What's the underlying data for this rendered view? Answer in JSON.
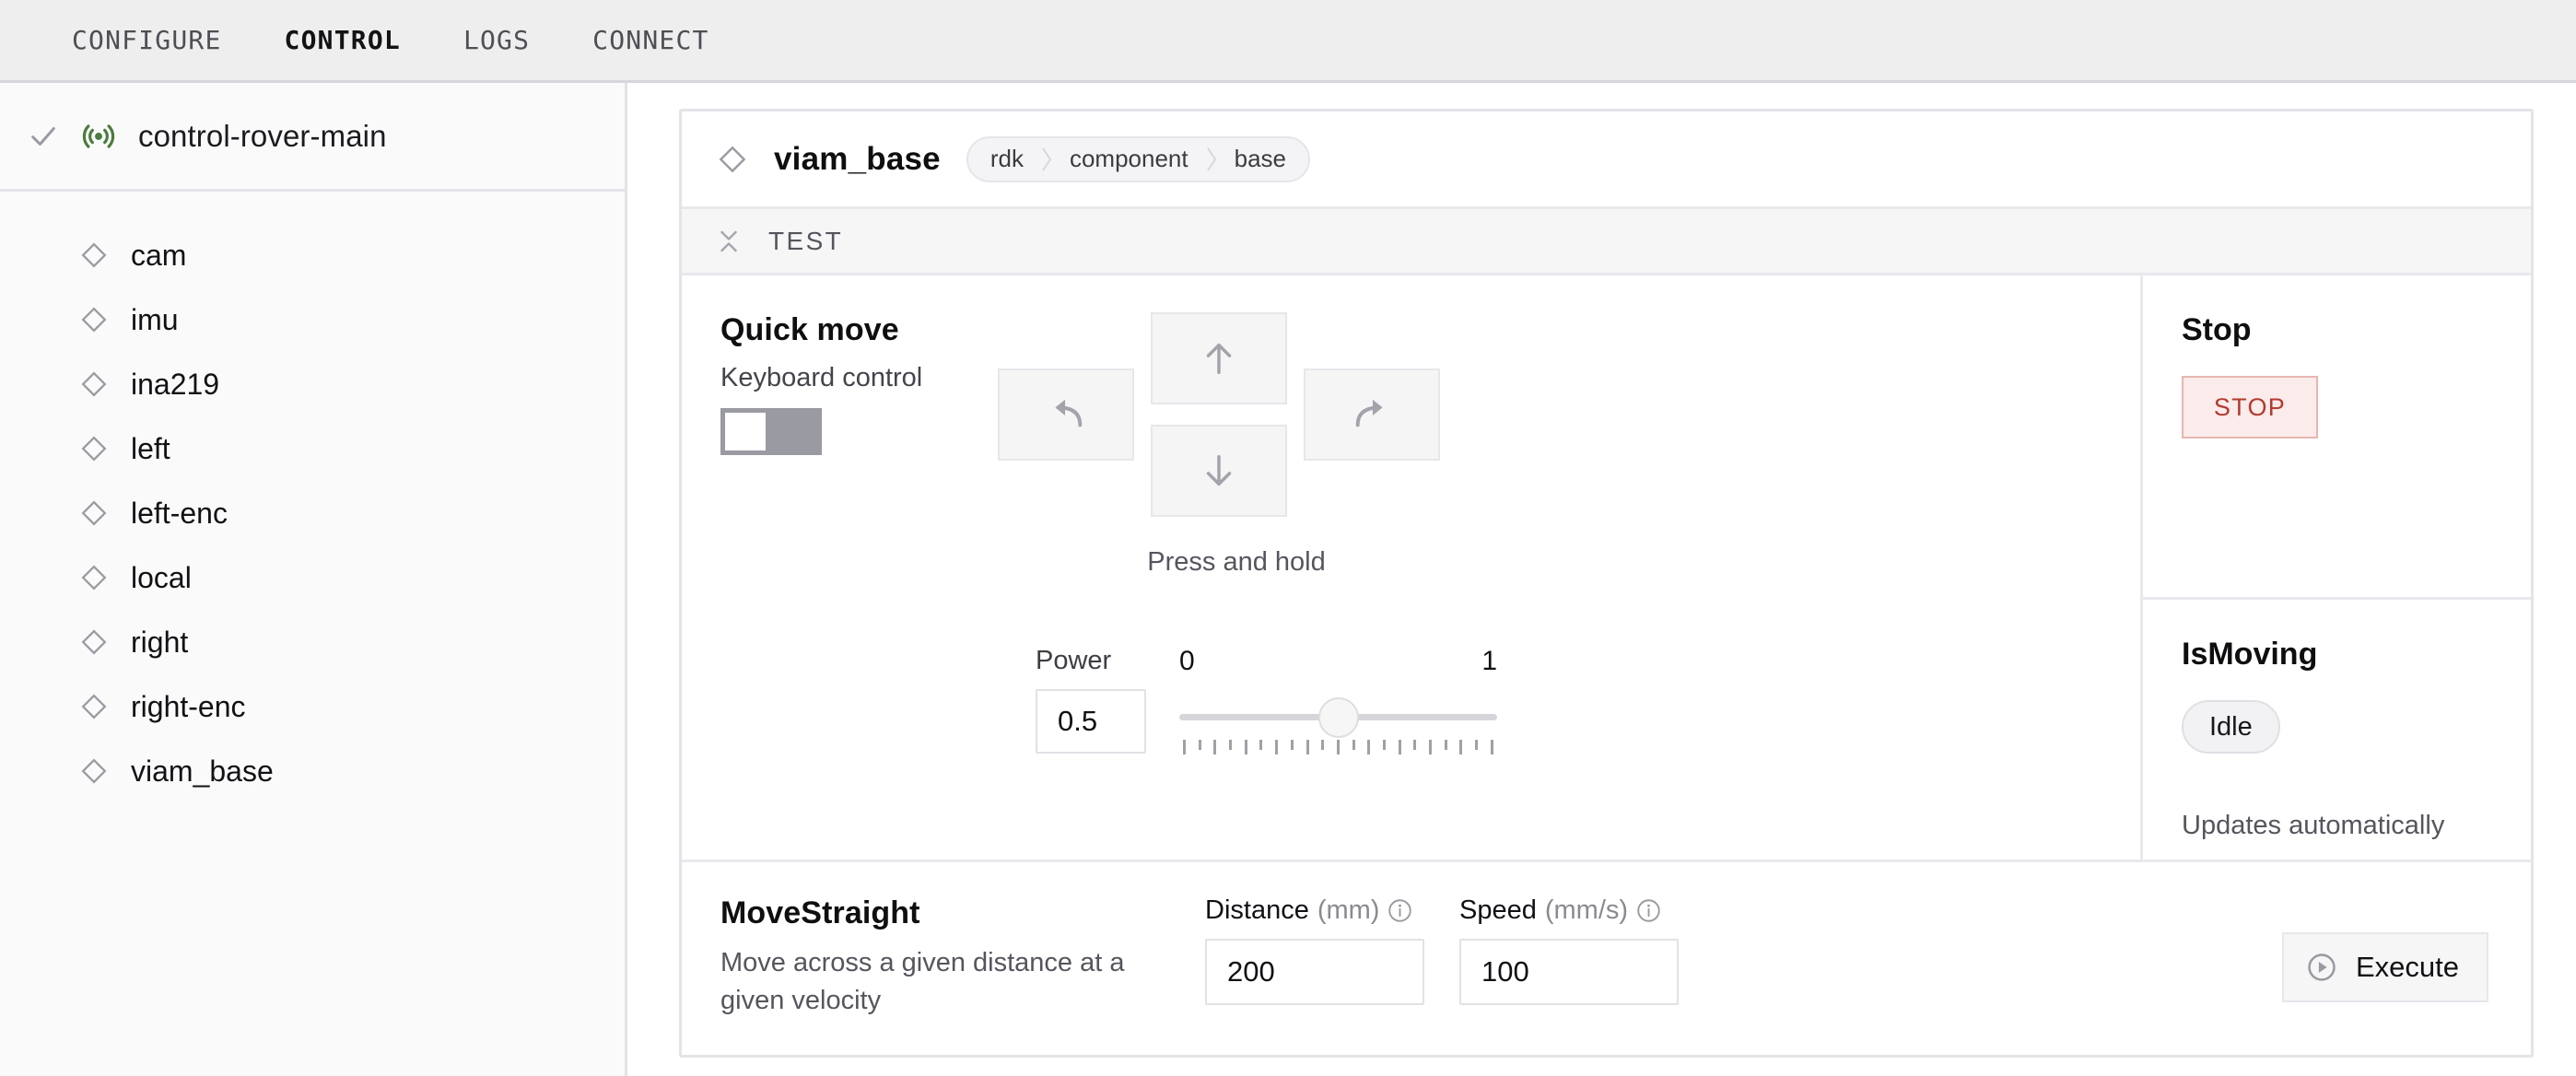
{
  "topnav": {
    "tabs": [
      {
        "label": "CONFIGURE",
        "active": false
      },
      {
        "label": "CONTROL",
        "active": true
      },
      {
        "label": "LOGS",
        "active": false
      },
      {
        "label": "CONNECT",
        "active": false
      }
    ]
  },
  "sidebar": {
    "machine": {
      "name": "control-rover-main",
      "status_icon": "signal-icon",
      "check_icon": "check-icon"
    },
    "resources": [
      {
        "label": "cam",
        "icon": "diamond-icon"
      },
      {
        "label": "imu",
        "icon": "diamond-icon"
      },
      {
        "label": "ina219",
        "icon": "diamond-icon"
      },
      {
        "label": "left",
        "icon": "diamond-icon"
      },
      {
        "label": "left-enc",
        "icon": "diamond-icon"
      },
      {
        "label": "local",
        "icon": "diamond-icon"
      },
      {
        "label": "right",
        "icon": "diamond-icon"
      },
      {
        "label": "right-enc",
        "icon": "diamond-icon"
      },
      {
        "label": "viam_base",
        "icon": "diamond-icon"
      }
    ]
  },
  "card": {
    "title": "viam_base",
    "breadcrumbs": [
      "rdk",
      "component",
      "base"
    ],
    "test_section_label": "TEST"
  },
  "quick_move": {
    "title": "Quick move",
    "keyboard_control_label": "Keyboard control",
    "keyboard_control_enabled": "off",
    "buttons": [
      {
        "name": "move-forward-button",
        "icon": "arrow-up-icon"
      },
      {
        "name": "move-backward-button",
        "icon": "arrow-down-icon"
      },
      {
        "name": "rotate-left-button",
        "icon": "rotate-left-icon"
      },
      {
        "name": "rotate-right-button",
        "icon": "rotate-right-icon"
      }
    ],
    "hint": "Press and hold",
    "power": {
      "label": "Power",
      "value": "0.5",
      "min": "0",
      "max": "1",
      "tick_count": 21
    }
  },
  "status_rail": {
    "stop": {
      "title": "Stop",
      "button_label": "STOP",
      "accent_color": "#b4392f",
      "background_color": "#fbeceb"
    },
    "is_moving": {
      "title": "IsMoving",
      "value": "Idle",
      "note": "Updates automatically"
    }
  },
  "move_straight": {
    "title": "MoveStraight",
    "description": "Move across a given distance at a given velocity",
    "fields": [
      {
        "label": "Distance",
        "unit": "(mm)",
        "value": "200",
        "info_icon": "info-icon"
      },
      {
        "label": "Speed",
        "unit": "(mm/s)",
        "value": "100",
        "info_icon": "info-icon"
      }
    ],
    "execute_label": "Execute"
  }
}
